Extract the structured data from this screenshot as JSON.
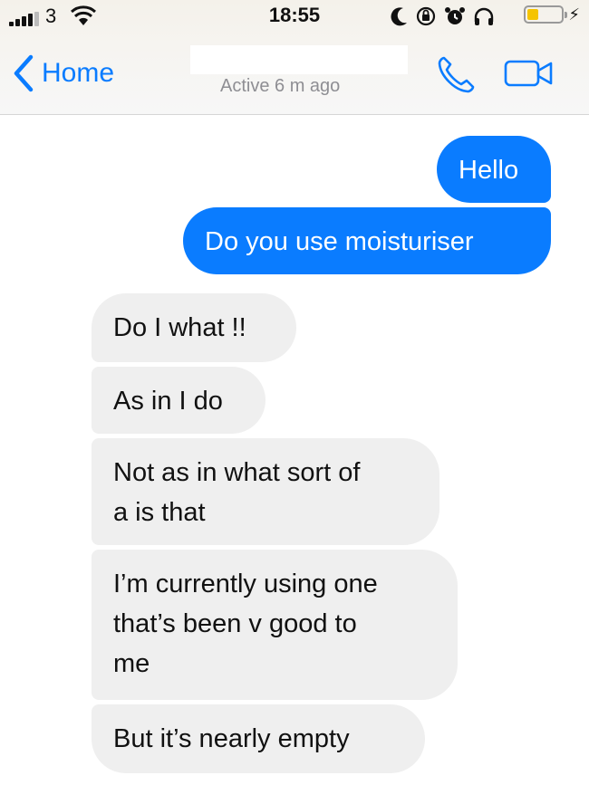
{
  "status_bar": {
    "carrier": "3",
    "time": "18:55",
    "icons": [
      "signal-icon",
      "wifi-icon",
      "moon-icon",
      "orientation-lock-icon",
      "alarm-icon",
      "headphones-icon",
      "battery-icon",
      "charging-icon"
    ],
    "battery_level": 0.25,
    "battery_color": "#f5c400"
  },
  "nav": {
    "back_label": "Home",
    "active_status": "Active 6 m ago",
    "accent_color": "#0a7cff"
  },
  "messages": [
    {
      "direction": "outgoing",
      "text": "Hello"
    },
    {
      "direction": "outgoing",
      "text": "Do you use moisturiser"
    },
    {
      "direction": "incoming",
      "text": "Do I what !!"
    },
    {
      "direction": "incoming",
      "text": "As in I do"
    },
    {
      "direction": "incoming",
      "text": "Not as in what sort of\na is that"
    },
    {
      "direction": "incoming",
      "text": "I’m currently using one\nthat’s been v good to\nme"
    },
    {
      "direction": "incoming",
      "text": "But it’s nearly empty"
    }
  ]
}
